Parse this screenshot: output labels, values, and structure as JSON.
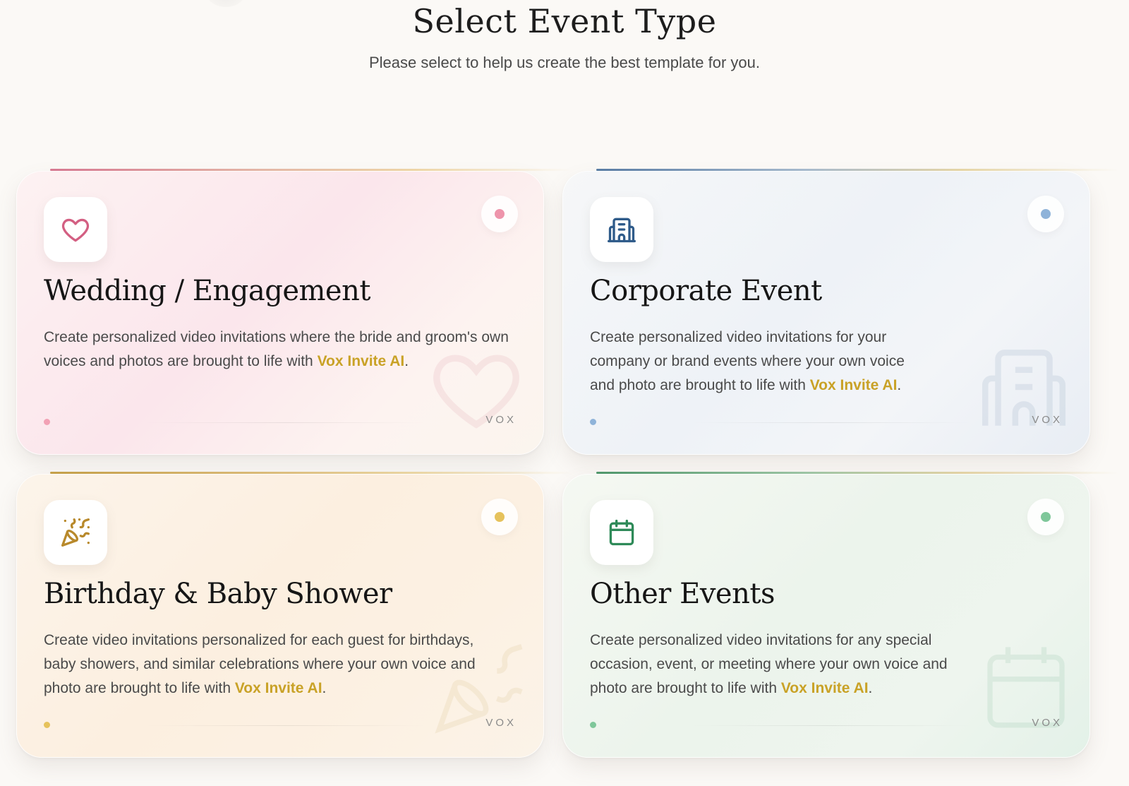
{
  "header": {
    "title": "Select Event Type",
    "subtitle": "Please select to help us create the best template for you."
  },
  "theme": {
    "brand_color": "#c9a227",
    "background": "#fbf9f6"
  },
  "cards": [
    {
      "id": "wedding",
      "icon": "heart-icon",
      "accent": "#d35f82",
      "title": "Wedding / Engagement",
      "desc_before": "Create personalized video invitations where the bride and groom's own voices and photos are brought to life with ",
      "brand": "Vox Invite AI",
      "desc_after": ".",
      "tag": "VOX"
    },
    {
      "id": "corporate",
      "icon": "building-icon",
      "accent": "#2f5b8a",
      "title": "Corporate Event",
      "desc_before": "Create personalized video invitations for your company or brand events where your own voice and photo are brought to life with ",
      "brand": "Vox Invite AI",
      "desc_after": ".",
      "tag": "VOX"
    },
    {
      "id": "birthday",
      "icon": "party-popper-icon",
      "accent": "#b8892b",
      "title": "Birthday & Baby Shower",
      "desc_before": "Create video invitations personalized for each guest for birthdays, baby showers, and similar celebrations where your own voice and photo are brought to life with ",
      "brand": "Vox Invite AI",
      "desc_after": ".",
      "tag": "VOX"
    },
    {
      "id": "other",
      "icon": "calendar-icon",
      "accent": "#2e8a58",
      "title": "Other Events",
      "desc_before": "Create personalized video invitations for any special occasion, event, or meeting where your own voice and photo are brought to life with ",
      "brand": "Vox Invite AI",
      "desc_after": ".",
      "tag": "VOX"
    }
  ]
}
